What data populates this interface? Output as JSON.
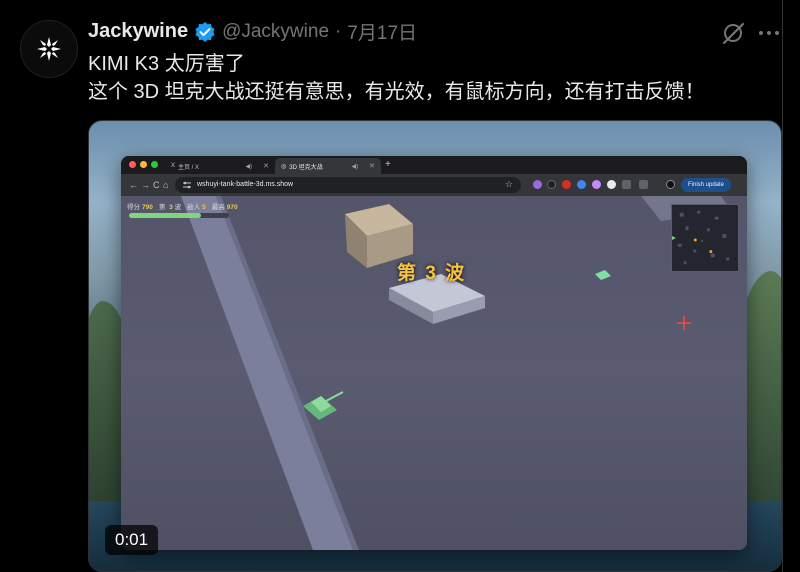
{
  "tweet": {
    "display_name": "Jackywine",
    "handle": "@Jackywine",
    "separator": "·",
    "date": "7月17日",
    "text_line1": "KIMI K3 太厉害了",
    "text_line2": "这个 3D 坦克大战还挺有意思，有光效，有鼠标方向，还有打击反馈！"
  },
  "icons": {
    "avatar": "logo-icon",
    "verified": "verified-badge-icon",
    "grok": "grok-icon",
    "more": "more-icon"
  },
  "media": {
    "timestamp": "0:01",
    "browser": {
      "tabs": [
        {
          "label": "主页 / X",
          "favicon": "X"
        },
        {
          "label": "3D 坦克大战",
          "favicon": "◎"
        }
      ],
      "new_tab": "+",
      "url": "wshuyi-tank-battle-3d.ms.show",
      "finish_update": "Finish update",
      "nav": {
        "back": "←",
        "forward": "→",
        "reload": "C",
        "home": "⌂"
      }
    },
    "game": {
      "score_label": "得分",
      "score": "790",
      "wave_label": "第",
      "wave_num": "3",
      "wave_unit": "波",
      "enemy_label": "敌人",
      "enemy": "5",
      "best_label": "最高",
      "best": "970",
      "wave_banner": "第 3 波",
      "health": 0.72
    }
  },
  "colors": {
    "background": "#000000",
    "text": "#e7e9ea",
    "muted": "#71767b",
    "verified": "#1d9bf0",
    "wave_text": "#f5c242",
    "finish_button": "#1f4f8a"
  }
}
